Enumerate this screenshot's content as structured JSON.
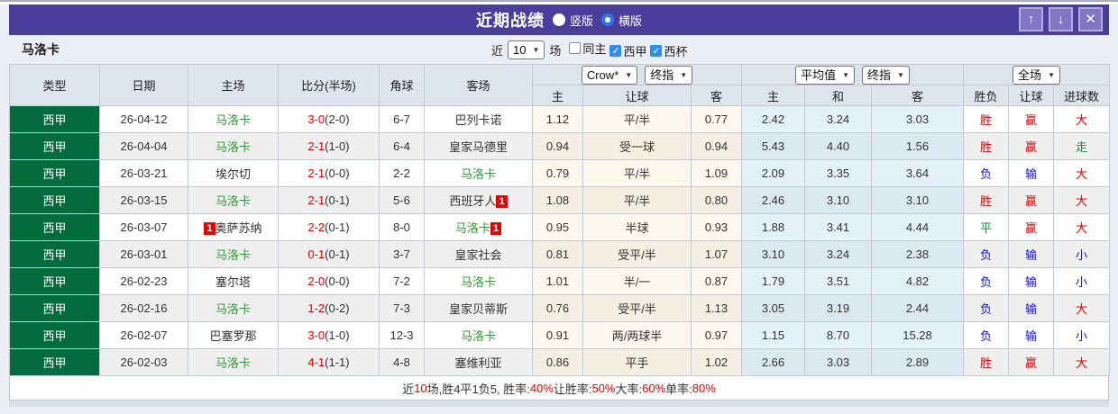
{
  "colors": {
    "accent_purple": "#4b3d9e",
    "league_badge_green": "#046b3d",
    "focus_team_green": "#339933",
    "loss_blue": "#1212d0",
    "win_red": "#e60000",
    "draw_green": "#009933",
    "checkbox_blue": "#2e8df0"
  },
  "titlebar": {
    "title": "近期战绩",
    "radio_vertical": "竖版",
    "radio_horizontal": "横版",
    "selected_layout": "横版",
    "btn_up": "↑",
    "btn_down": "↓",
    "btn_close": "✕"
  },
  "filterbar": {
    "team": "马洛卡",
    "near_label": "近",
    "count_value": "10",
    "games_label": "场",
    "checkboxes": [
      {
        "label": "同主",
        "checked": false
      },
      {
        "label": "西甲",
        "checked": true
      },
      {
        "label": "西杯",
        "checked": true
      }
    ]
  },
  "table": {
    "col_headers": [
      "类型",
      "日期",
      "主场",
      "比分(半场)",
      "角球",
      "客场"
    ],
    "dropdowns": {
      "crow": "Crow*",
      "final_odds_1": "终指",
      "average": "平均值",
      "final_odds_2": "终指",
      "full_match": "全场"
    },
    "sub_headers": [
      "主",
      "让球",
      "客",
      "主",
      "和",
      "客",
      "胜负",
      "让球",
      "进球数"
    ],
    "rows": [
      {
        "league": "西甲",
        "date": "26-04-12",
        "home": "马洛卡",
        "home_is_focus": true,
        "home_card": "",
        "score": "3-0",
        "half": "(2-0)",
        "corners": "6-7",
        "away": "巴列卡诺",
        "away_is_focus": false,
        "away_card": "",
        "let_home": "1.12",
        "let_line": "平/半",
        "let_away": "0.77",
        "avg_home": "2.42",
        "avg_draw": "3.24",
        "avg_away": "3.03",
        "outcome": {
          "text": "胜",
          "color": "red"
        },
        "let_outcome": {
          "text": "赢",
          "color": "red"
        },
        "goal_outcome": {
          "text": "大",
          "color": "red"
        }
      },
      {
        "league": "西甲",
        "date": "26-04-04",
        "home": "马洛卡",
        "home_is_focus": true,
        "home_card": "",
        "score": "2-1",
        "half": "(1-0)",
        "corners": "6-4",
        "away": "皇家马德里",
        "away_is_focus": false,
        "away_card": "",
        "let_home": "0.94",
        "let_line": "受一球",
        "let_away": "0.94",
        "avg_home": "5.43",
        "avg_draw": "4.40",
        "avg_away": "1.56",
        "outcome": {
          "text": "胜",
          "color": "red"
        },
        "let_outcome": {
          "text": "赢",
          "color": "red"
        },
        "goal_outcome": {
          "text": "走",
          "color": "green"
        }
      },
      {
        "league": "西甲",
        "date": "26-03-21",
        "home": "埃尔切",
        "home_is_focus": false,
        "home_card": "",
        "score": "2-1",
        "half": "(0-0)",
        "corners": "2-2",
        "away": "马洛卡",
        "away_is_focus": true,
        "away_card": "",
        "let_home": "0.79",
        "let_line": "平/半",
        "let_away": "1.09",
        "avg_home": "2.09",
        "avg_draw": "3.35",
        "avg_away": "3.64",
        "outcome": {
          "text": "负",
          "color": "blue"
        },
        "let_outcome": {
          "text": "输",
          "color": "blue"
        },
        "goal_outcome": {
          "text": "大",
          "color": "red"
        }
      },
      {
        "league": "西甲",
        "date": "26-03-15",
        "home": "马洛卡",
        "home_is_focus": true,
        "home_card": "",
        "score": "2-1",
        "half": "(0-1)",
        "corners": "5-6",
        "away": "西班牙人",
        "away_is_focus": false,
        "away_card": "1",
        "let_home": "1.08",
        "let_line": "平/半",
        "let_away": "0.80",
        "avg_home": "2.46",
        "avg_draw": "3.10",
        "avg_away": "3.10",
        "outcome": {
          "text": "胜",
          "color": "red"
        },
        "let_outcome": {
          "text": "赢",
          "color": "red"
        },
        "goal_outcome": {
          "text": "大",
          "color": "red"
        }
      },
      {
        "league": "西甲",
        "date": "26-03-07",
        "home": "奥萨苏纳",
        "home_is_focus": false,
        "home_card": "1",
        "score": "2-2",
        "half": "(0-1)",
        "corners": "8-0",
        "away": "马洛卡",
        "away_is_focus": true,
        "away_card": "1",
        "let_home": "0.95",
        "let_line": "半球",
        "let_away": "0.93",
        "avg_home": "1.88",
        "avg_draw": "3.41",
        "avg_away": "4.44",
        "outcome": {
          "text": "平",
          "color": "green"
        },
        "let_outcome": {
          "text": "赢",
          "color": "red"
        },
        "goal_outcome": {
          "text": "大",
          "color": "red"
        }
      },
      {
        "league": "西甲",
        "date": "26-03-01",
        "home": "马洛卡",
        "home_is_focus": true,
        "home_card": "",
        "score": "0-1",
        "half": "(0-1)",
        "corners": "3-7",
        "away": "皇家社会",
        "away_is_focus": false,
        "away_card": "",
        "let_home": "0.81",
        "let_line": "受平/半",
        "let_away": "1.07",
        "avg_home": "3.10",
        "avg_draw": "3.24",
        "avg_away": "2.38",
        "outcome": {
          "text": "负",
          "color": "blue"
        },
        "let_outcome": {
          "text": "输",
          "color": "blue"
        },
        "goal_outcome": {
          "text": "小",
          "color": "blue"
        }
      },
      {
        "league": "西甲",
        "date": "26-02-23",
        "home": "塞尔塔",
        "home_is_focus": false,
        "home_card": "",
        "score": "2-0",
        "half": "(0-0)",
        "corners": "7-2",
        "away": "马洛卡",
        "away_is_focus": true,
        "away_card": "",
        "let_home": "1.01",
        "let_line": "半/一",
        "let_away": "0.87",
        "avg_home": "1.79",
        "avg_draw": "3.51",
        "avg_away": "4.82",
        "outcome": {
          "text": "负",
          "color": "blue"
        },
        "let_outcome": {
          "text": "输",
          "color": "blue"
        },
        "goal_outcome": {
          "text": "小",
          "color": "blue"
        }
      },
      {
        "league": "西甲",
        "date": "26-02-16",
        "home": "马洛卡",
        "home_is_focus": true,
        "home_card": "",
        "score": "1-2",
        "half": "(0-2)",
        "corners": "7-3",
        "away": "皇家贝蒂斯",
        "away_is_focus": false,
        "away_card": "",
        "let_home": "0.76",
        "let_line": "受平/半",
        "let_away": "1.13",
        "avg_home": "3.05",
        "avg_draw": "3.19",
        "avg_away": "2.44",
        "outcome": {
          "text": "负",
          "color": "blue"
        },
        "let_outcome": {
          "text": "输",
          "color": "blue"
        },
        "goal_outcome": {
          "text": "大",
          "color": "red"
        }
      },
      {
        "league": "西甲",
        "date": "26-02-07",
        "home": "巴塞罗那",
        "home_is_focus": false,
        "home_card": "",
        "score": "3-0",
        "half": "(1-0)",
        "corners": "12-3",
        "away": "马洛卡",
        "away_is_focus": true,
        "away_card": "",
        "let_home": "0.91",
        "let_line": "两/两球半",
        "let_away": "0.97",
        "avg_home": "1.15",
        "avg_draw": "8.70",
        "avg_away": "15.28",
        "outcome": {
          "text": "负",
          "color": "blue"
        },
        "let_outcome": {
          "text": "输",
          "color": "blue"
        },
        "goal_outcome": {
          "text": "小",
          "color": "blue"
        }
      },
      {
        "league": "西甲",
        "date": "26-02-03",
        "home": "马洛卡",
        "home_is_focus": true,
        "home_card": "",
        "score": "4-1",
        "half": "(1-1)",
        "corners": "4-8",
        "away": "塞维利亚",
        "away_is_focus": false,
        "away_card": "",
        "let_home": "0.86",
        "let_line": "平手",
        "let_away": "1.02",
        "avg_home": "2.66",
        "avg_draw": "3.03",
        "avg_away": "2.89",
        "outcome": {
          "text": "胜",
          "color": "red"
        },
        "let_outcome": {
          "text": "赢",
          "color": "red"
        },
        "goal_outcome": {
          "text": "大",
          "color": "red"
        }
      }
    ]
  },
  "footer": {
    "segments": [
      {
        "text": "近",
        "color": "dark"
      },
      {
        "text": "10",
        "color": "red"
      },
      {
        "text": "场,胜4平1负5, 胜率:",
        "color": "dark"
      },
      {
        "text": "40%",
        "color": "red"
      },
      {
        "text": " 让胜率:",
        "color": "dark"
      },
      {
        "text": "50%",
        "color": "red"
      },
      {
        "text": " 大率:",
        "color": "dark"
      },
      {
        "text": "60%",
        "color": "red"
      },
      {
        "text": " 单率:",
        "color": "dark"
      },
      {
        "text": "80%",
        "color": "red"
      }
    ]
  }
}
